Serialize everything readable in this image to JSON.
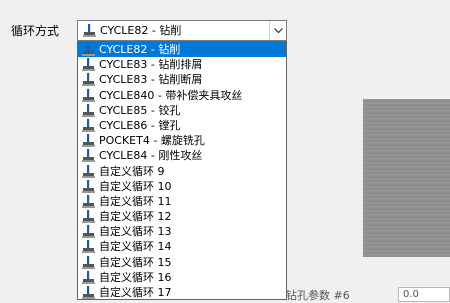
{
  "form": {
    "label": "循环方式",
    "combo": {
      "selected": "CYCLE82 - 钻削",
      "options": [
        "CYCLE82 - 钻削",
        "CYCLE83 - 钻削排屑",
        "CYCLE83 - 钻削断屑",
        "CYCLE840 - 带补偿夹具攻丝",
        "CYCLE85 - 铰孔",
        "CYCLE86 - 镗孔",
        "POCKET4 - 螺旋铣孔",
        "CYCLE84 - 刚性攻丝",
        "自定义循环 9",
        "自定义循环 10",
        "自定义循环 11",
        "自定义循环 12",
        "自定义循环 13",
        "自定义循环 14",
        "自定义循环 15",
        "自定义循环 16",
        "自定义循环 17"
      ]
    },
    "param_label": "钻孔参数 #6",
    "param_value": "0.0"
  },
  "icons": {
    "item_icon": "drill-cycle-icon",
    "arrow": "chevron-down-icon"
  },
  "colors": {
    "selection": "#0078d7",
    "icon_blue": "#1e5ab4"
  }
}
